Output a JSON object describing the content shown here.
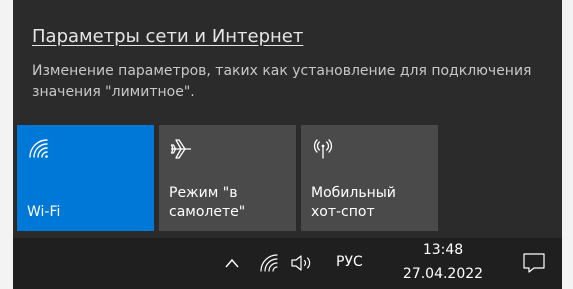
{
  "flyout": {
    "settings_link": "Параметры сети и Интернет",
    "settings_desc": "Изменение параметров, таких как установление для подключения значения \"лимитное\"."
  },
  "tiles": [
    {
      "label": "Wi-Fi",
      "icon": "wifi-icon",
      "state": "on",
      "color": "#0078d7"
    },
    {
      "label": "Режим \"в\nсамолете\"",
      "icon": "airplane-icon",
      "state": "off",
      "color": "#4a4a4a"
    },
    {
      "label": "Мобильный\nхот-спот",
      "icon": "hotspot-icon",
      "state": "off",
      "color": "#4a4a4a"
    }
  ],
  "taskbar": {
    "tray_icons": [
      "chevron-up-icon",
      "wifi-icon",
      "volume-icon"
    ],
    "language": "РУС",
    "time": "13:48",
    "date": "27.04.2022",
    "notifications_icon": "notifications-icon"
  }
}
